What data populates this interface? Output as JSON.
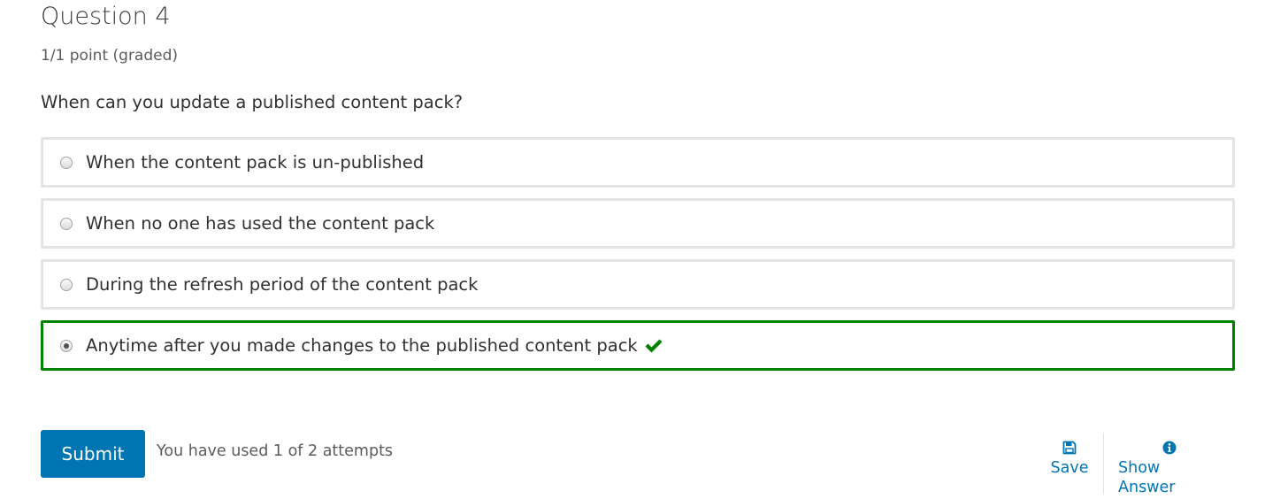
{
  "question": {
    "title": "Question 4",
    "points": "1/1 point (graded)",
    "prompt": "When can you update a published content pack?"
  },
  "choices": [
    {
      "label": "When the content pack is un-published",
      "selected": false,
      "correct": false
    },
    {
      "label": "When no one has used the content pack",
      "selected": false,
      "correct": false
    },
    {
      "label": "During the refresh period of the content pack",
      "selected": false,
      "correct": false
    },
    {
      "label": "Anytime after you made changes to the published content pack",
      "selected": true,
      "correct": true
    }
  ],
  "icons": {
    "correct": "checkmark-icon",
    "save": "save-icon",
    "show_answer": "info-icon"
  },
  "actions": {
    "submit_label": "Submit",
    "attempts_text": "You have used 1 of 2 attempts",
    "save_label": "Save",
    "show_answer_label": "Show Answer"
  },
  "colors": {
    "accent": "#0075b4",
    "correct": "#008100",
    "choice_border": "#e4e4e4"
  }
}
